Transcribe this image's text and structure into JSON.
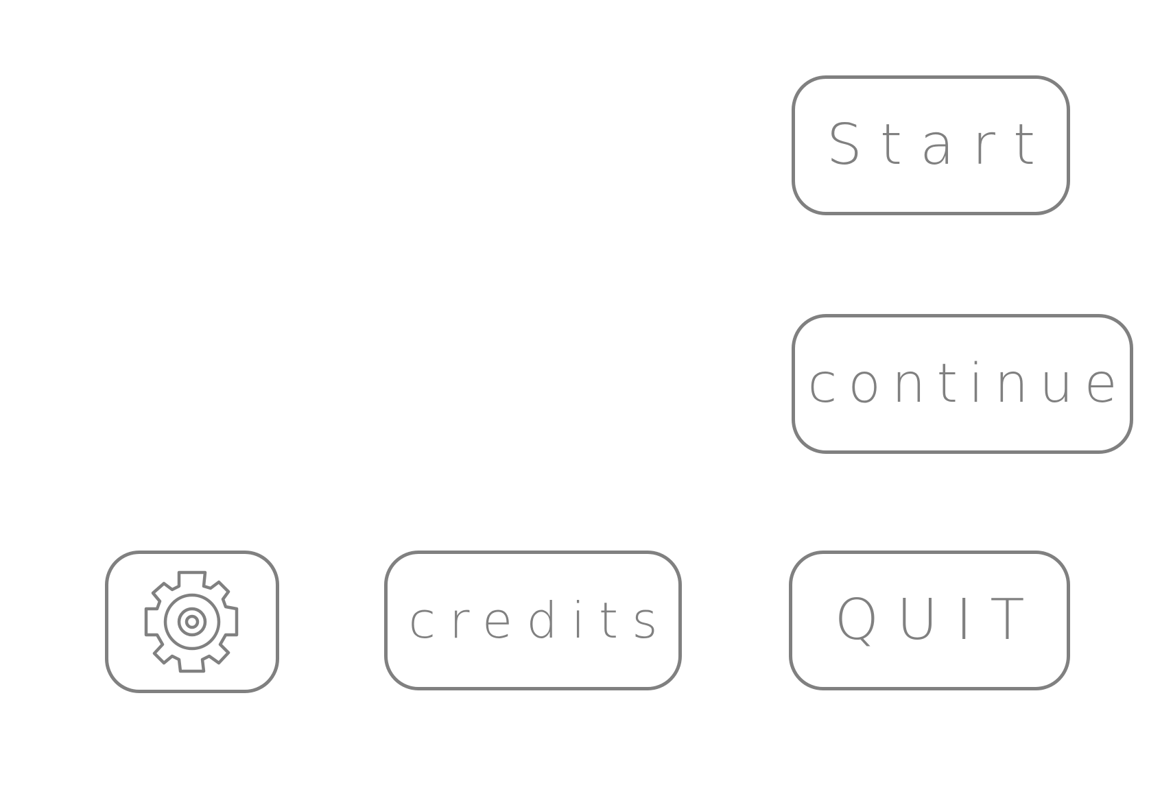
{
  "menu": {
    "start_label": "Start",
    "continue_label": "continue",
    "quit_label": "QUIT",
    "credits_label": "credits",
    "settings_icon": "gear-icon"
  },
  "colors": {
    "stroke": "#808080",
    "background": "#ffffff"
  }
}
